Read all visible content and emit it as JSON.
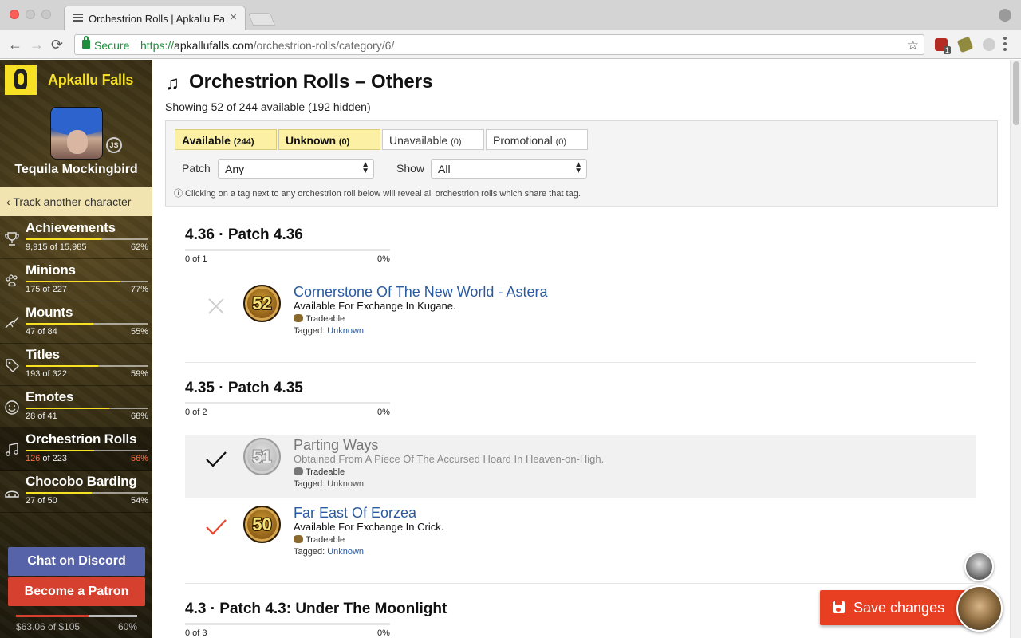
{
  "browser": {
    "tab_title": "Orchestrion Rolls | Apkallu Falls",
    "tab_close": "×",
    "secure_label": "Secure",
    "url_scheme": "https://",
    "url_host": "apkallufalls.com",
    "url_path": "/orchestrion-rolls/category/6/",
    "ext_badge": "1",
    "nav": {
      "back": "←",
      "forward": "→",
      "reload": "⟳",
      "star": "☆"
    }
  },
  "sidebar": {
    "brand": "Apkallu Falls",
    "character_name": "Tequila Mockingbird",
    "server_badge": "JS",
    "track_another": "Track another character",
    "items": [
      {
        "label": "Achievements",
        "count": "9,915 of 15,985",
        "count_owned": "",
        "count_rest": "",
        "percent": "62%",
        "fill": 0.62,
        "icon": "trophy-icon"
      },
      {
        "label": "Minions",
        "count": "175 of 227",
        "count_owned": "",
        "count_rest": "",
        "percent": "77%",
        "fill": 0.77,
        "icon": "paw-icon"
      },
      {
        "label": "Mounts",
        "count": "47 of 84",
        "count_owned": "",
        "count_rest": "",
        "percent": "55%",
        "fill": 0.55,
        "icon": "bird-icon"
      },
      {
        "label": "Titles",
        "count": "193 of 322",
        "count_owned": "",
        "count_rest": "",
        "percent": "59%",
        "fill": 0.59,
        "icon": "tag-icon"
      },
      {
        "label": "Emotes",
        "count": "28 of 41",
        "count_owned": "",
        "count_rest": "",
        "percent": "68%",
        "fill": 0.68,
        "icon": "smile-icon"
      },
      {
        "label": "Orchestrion Rolls",
        "count": "",
        "count_owned": "126",
        "count_rest": " of 223",
        "percent": "56%",
        "fill": 0.56,
        "icon": "music-note-icon"
      },
      {
        "label": "Chocobo Barding",
        "count": "27 of 50",
        "count_owned": "",
        "count_rest": "",
        "percent": "54%",
        "fill": 0.54,
        "icon": "barding-icon"
      }
    ],
    "discord_label": "Chat on Discord",
    "patron_label": "Become a Patron",
    "patron_money": "$63.06 of $105",
    "patron_percent": "60%",
    "patron_fill": 0.6
  },
  "main": {
    "title": "Orchestrion Rolls – Others",
    "title_icon": "♫",
    "showing": "Showing 52 of 244 available (192 hidden)",
    "filters": {
      "tabs": [
        {
          "label": "Available",
          "count": "(244)"
        },
        {
          "label": "Unknown",
          "count": "(0)"
        },
        {
          "label": "Unavailable",
          "count": "(0)"
        },
        {
          "label": "Promotional",
          "count": "(0)"
        }
      ],
      "patch_label": "Patch",
      "patch_value": "Any",
      "show_label": "Show",
      "show_value": "All",
      "info": "ⓘ Clicking on a tag next to any orchestrion roll below will reveal all orchestrion rolls which share that tag."
    },
    "patches": [
      {
        "header": "4.36 · Patch 4.36",
        "count": "0 of 1",
        "percent": "0%"
      },
      {
        "header": "4.35 · Patch 4.35",
        "count": "0 of 2",
        "percent": "0%"
      },
      {
        "header": "4.3 · Patch 4.3: Under The Moonlight",
        "count": "0 of 3",
        "percent": "0%"
      }
    ],
    "rolls": [
      {
        "number": "52",
        "name": "Cornerstone Of The New World - Astera",
        "desc": "Available For Exchange In Kugane.",
        "trade": "Tradeable",
        "tag_label": "Tagged:",
        "tag": "Unknown",
        "mark": "×"
      },
      {
        "number": "51",
        "name": "Parting Ways",
        "desc": "Obtained From A Piece Of The Accursed Hoard In Heaven-on-High.",
        "trade": "Tradeable",
        "tag_label": "Tagged:",
        "tag": "Unknown",
        "mark": "✓"
      },
      {
        "number": "50",
        "name": "Far East Of Eorzea",
        "desc": "Available For Exchange In Crick.",
        "trade": "Tradeable",
        "tag_label": "Tagged:",
        "tag": "Unknown",
        "mark": "✓"
      }
    ],
    "save_label": "Save changes"
  },
  "colors": {
    "brand_yellow": "#f7e125",
    "accent_red": "#e83e21",
    "link_blue": "#2a5aa0",
    "discord": "#5663a8",
    "patreon": "#d5412e"
  }
}
